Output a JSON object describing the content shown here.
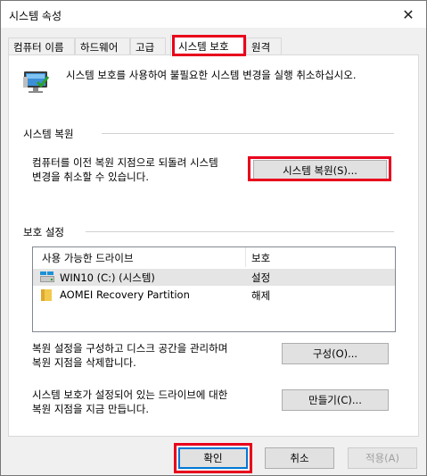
{
  "window": {
    "title": "시스템 속성",
    "close_glyph": "✕"
  },
  "tabs": [
    {
      "label": "컴퓨터 이름"
    },
    {
      "label": "하드웨어"
    },
    {
      "label": "고급"
    },
    {
      "label": "시스템 보호",
      "active": true
    },
    {
      "label": "원격"
    }
  ],
  "intro": {
    "text": "시스템 보호를 사용하여 불필요한 시스템 변경을 실행 취소하십시오.",
    "icon": "system-protection-icon"
  },
  "restore": {
    "title": "시스템 복원",
    "description_line1": "컴퓨터를 이전 복원 지점으로 되돌려 시스템",
    "description_line2": "변경을 취소할 수 있습니다.",
    "button_label": "시스템 복원(S)..."
  },
  "protection": {
    "title": "보호 설정",
    "columns": [
      "사용 가능한 드라이브",
      "보호"
    ],
    "drives": [
      {
        "name": "WIN10 (C:) (시스템)",
        "status": "설정",
        "icon": "system-drive-icon"
      },
      {
        "name": "AOMEI Recovery Partition",
        "status": "해제",
        "icon": "folder-drive-icon"
      }
    ],
    "configure_desc_line1": "복원 설정을 구성하고 디스크 공간을 관리하며",
    "configure_desc_line2": "복원 지점을 삭제합니다.",
    "configure_button": "구성(O)...",
    "create_desc_line1": "시스템 보호가 설정되어 있는 드라이브에 대한",
    "create_desc_line2": "복원 지점을 지금 만듭니다.",
    "create_button": "만들기(C)..."
  },
  "footer": {
    "ok": "확인",
    "cancel": "취소",
    "apply": "적용(A)"
  },
  "colors": {
    "highlight": "#e8001c",
    "accent": "#0078d7"
  }
}
